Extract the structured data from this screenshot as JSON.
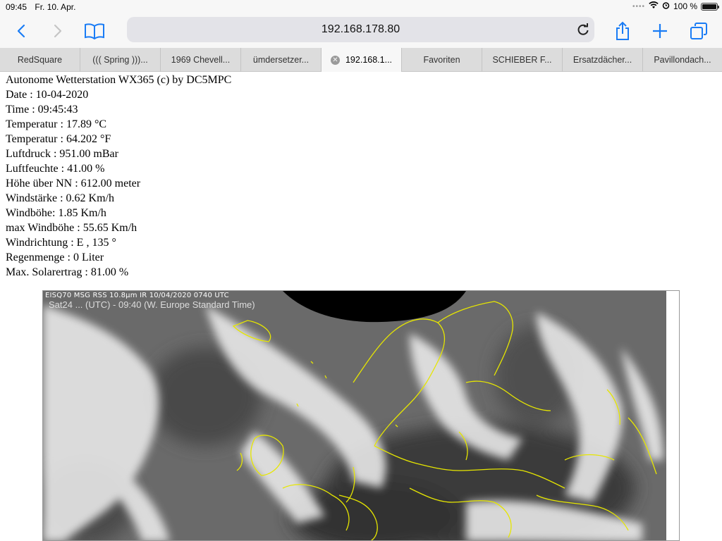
{
  "status_bar": {
    "time": "09:45",
    "date": "Fr. 10. Apr.",
    "battery": "100 %"
  },
  "toolbar": {
    "url": "192.168.178.80"
  },
  "tabs": [
    {
      "label": "RedSquare"
    },
    {
      "label": "((( Spring )))..."
    },
    {
      "label": "1969 Chevell..."
    },
    {
      "label": "ümdersetzer..."
    },
    {
      "label": "192.168.1...",
      "active": true
    },
    {
      "label": "Favoriten"
    },
    {
      "label": "SCHIEBER F..."
    },
    {
      "label": "Ersatzdächer..."
    },
    {
      "label": "Pavillondach..."
    }
  ],
  "weather": {
    "lines": [
      "Autonome Wetterstation WX365 (c) by DC5MPC",
      "Date : 10-04-2020",
      "Time : 09:45:43",
      "Temperatur : 17.89 °C",
      "Temperatur : 64.202 °F",
      "Luftdruck : 951.00 mBar",
      "Luftfeuchte : 41.00 %",
      "Höhe über NN : 612.00 meter",
      "Windstärke : 0.62 Km/h",
      "Windböhe: 1.85 Km/h",
      "max Windböhe : 55.65 Km/h",
      "Windrichtung : E , 135 °",
      "Regenmenge : 0 Liter",
      "Max. Solarertrag : 81.00 %"
    ]
  },
  "satellite": {
    "caption": "EISQ70 MSG RSS 10.8µm IR 10/04/2020 0740 UTC",
    "subcaption": "Sat24 ... (UTC) - 09:40 (W. Europe Standard Time)"
  },
  "colors": {
    "accent": "#1a7cf5",
    "coastline": "#e6e600"
  }
}
